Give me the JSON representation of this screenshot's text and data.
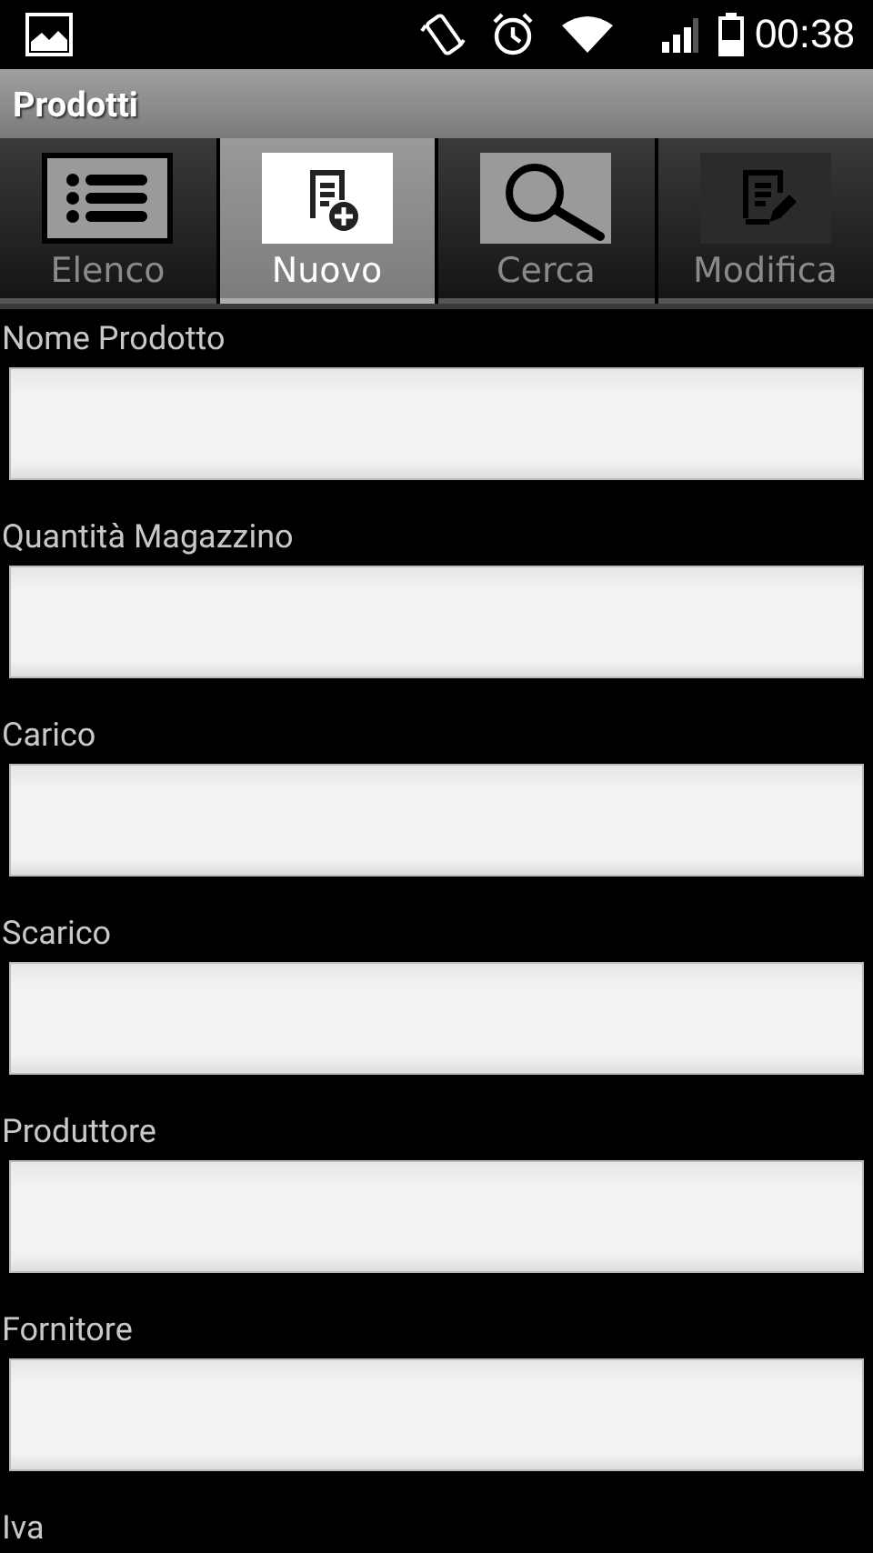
{
  "status_bar": {
    "time": "00:38"
  },
  "title": "Prodotti",
  "tabs": [
    {
      "label": "Elenco",
      "selected": false
    },
    {
      "label": "Nuovo",
      "selected": true
    },
    {
      "label": "Cerca",
      "selected": false
    },
    {
      "label": "Modifica",
      "selected": false
    }
  ],
  "fields": [
    {
      "label": "Nome Prodotto"
    },
    {
      "label": "Quantità Magazzino"
    },
    {
      "label": "Carico"
    },
    {
      "label": "Scarico"
    },
    {
      "label": "Produttore"
    },
    {
      "label": "Fornitore"
    },
    {
      "label": "Iva"
    }
  ]
}
